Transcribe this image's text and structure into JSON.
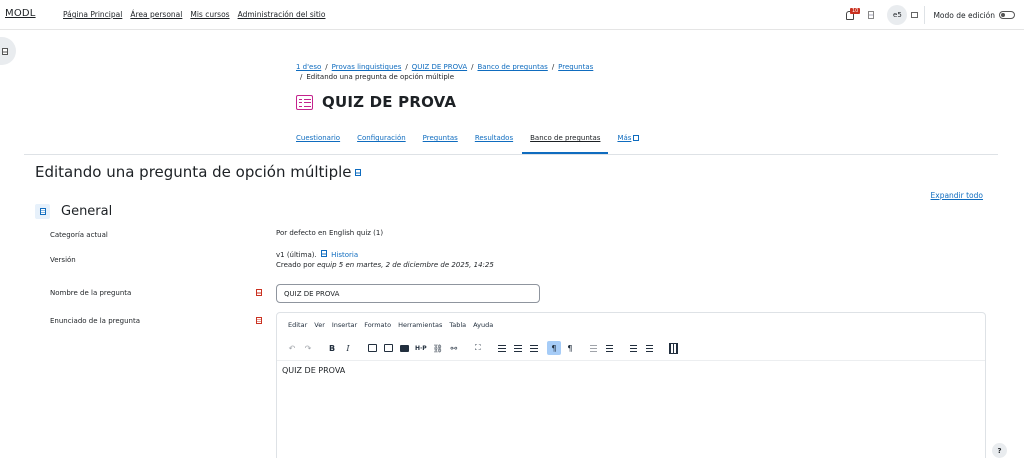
{
  "nav": {
    "brand": "MODL",
    "links": [
      "Página Principal",
      "Área personal",
      "Mis cursos",
      "Administración del sitio"
    ],
    "notif_count": "10",
    "avatar_initials": "e5",
    "edit_mode_label": "Modo de edición"
  },
  "breadcrumb": {
    "items": [
      "1 d'eso",
      "Provas linguistiques",
      "QUIZ DE PROVA",
      "Banco de preguntas",
      "Preguntas"
    ],
    "current": "Editando una pregunta de opción múltiple"
  },
  "header": {
    "title": "QUIZ DE PROVA"
  },
  "tabs": [
    {
      "label": "Cuestionario"
    },
    {
      "label": "Configuración"
    },
    {
      "label": "Preguntas"
    },
    {
      "label": "Resultados"
    },
    {
      "label": "Banco de preguntas",
      "active": true
    },
    {
      "label": "Más"
    }
  ],
  "page": {
    "heading": "Editando una pregunta de opción múltiple",
    "expand_all": "Expandir todo",
    "section_title": "General"
  },
  "form": {
    "category_label": "Categoría actual",
    "category_value": "Por defecto en English quiz (1)",
    "version_label": "Versión",
    "version_value": "v1 (última).",
    "history_link": "Historia",
    "created_prefix": "Creado por",
    "created_detail": "equip 5 en martes, 2 de diciembre de 2025, 14:25",
    "name_label": "Nombre de la pregunta",
    "name_value": "QUIZ DE PROVA",
    "statement_label": "Enunciado de la pregunta"
  },
  "editor": {
    "menu": [
      "Editar",
      "Ver",
      "Insertar",
      "Formato",
      "Herramientas",
      "Tabla",
      "Ayuda"
    ],
    "content": "QUIZ DE PROVA"
  },
  "help_label": "?"
}
